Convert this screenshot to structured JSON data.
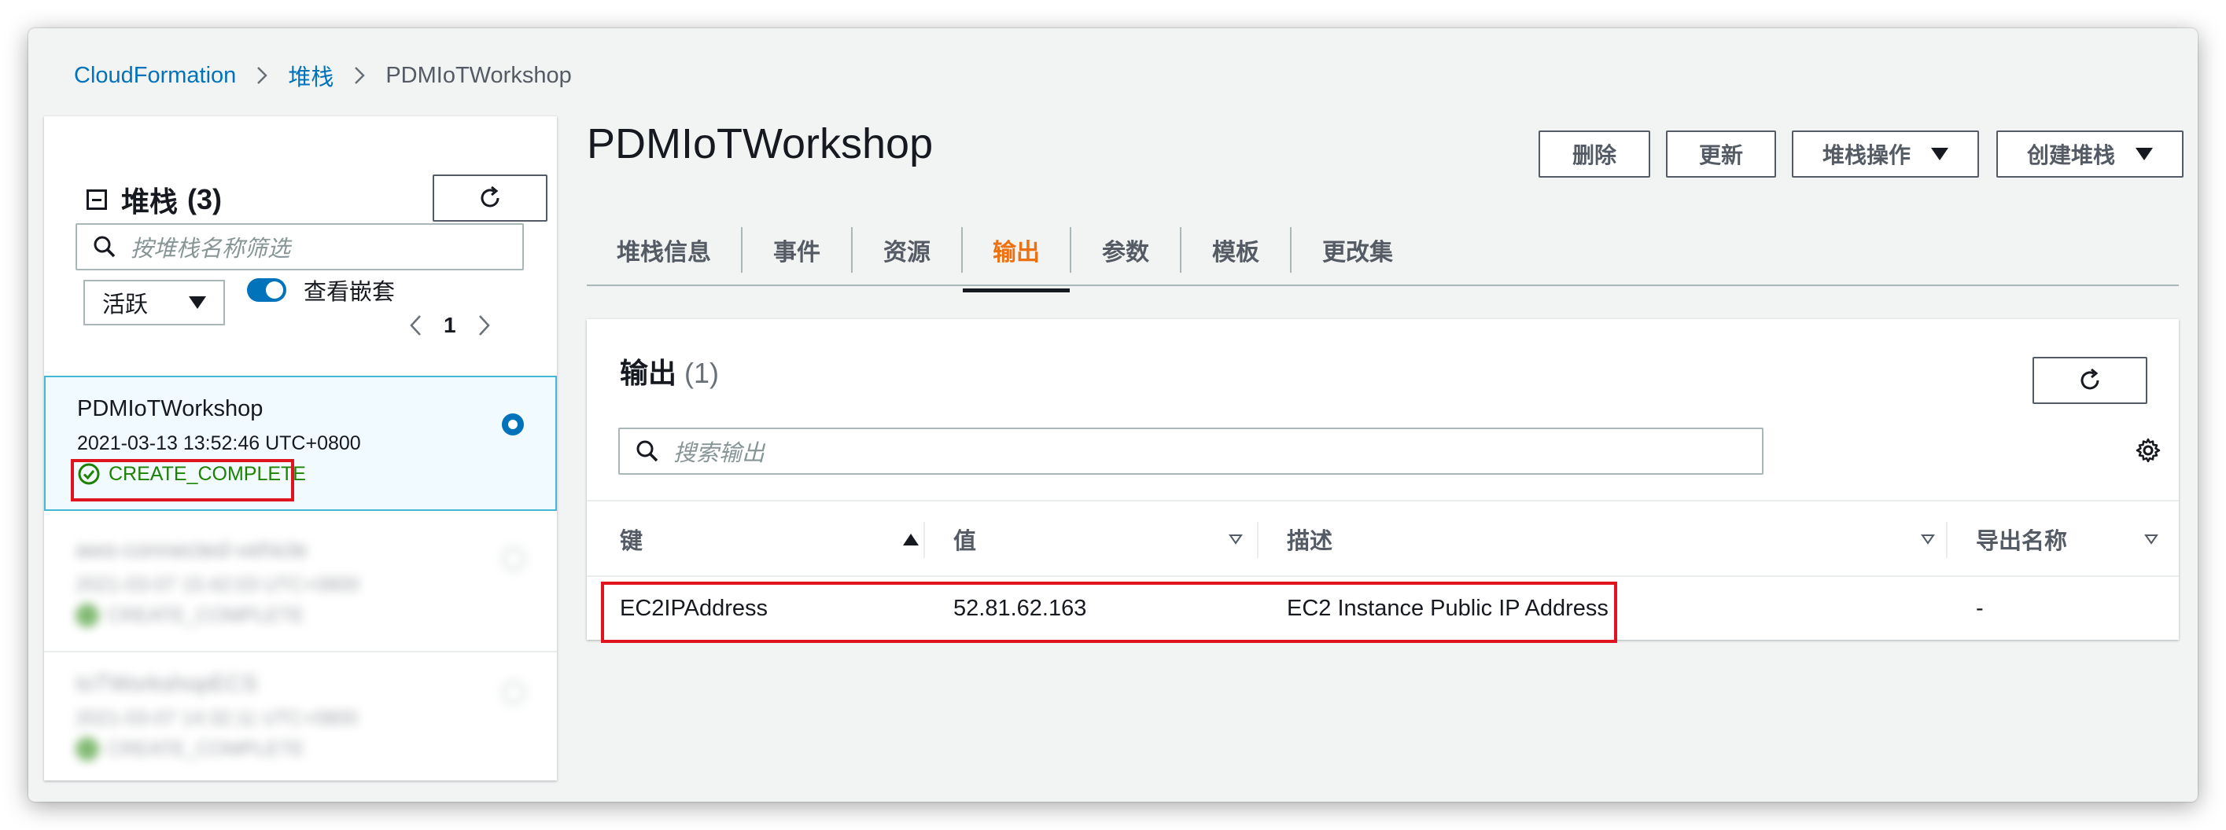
{
  "breadcrumb": {
    "root": "CloudFormation",
    "parent": "堆栈",
    "current": "PDMIoTWorkshop"
  },
  "sidebar": {
    "title": "堆栈",
    "count": "(3)",
    "search_placeholder": "按堆栈名称筛选",
    "filter_value": "活跃",
    "toggle_label": "查看嵌套",
    "page": "1",
    "selected_stack": {
      "name": "PDMIoTWorkshop",
      "date": "2021-03-13 13:52:46 UTC+0800",
      "status": "CREATE_COMPLETE"
    },
    "blurred_stacks": [
      {
        "name": "aws-connected-vehicle",
        "date": "2021-03-07 15:42:03 UTC+0800",
        "status": "CREATE_COMPLETE"
      },
      {
        "name": "IoTWorkshopECS",
        "date": "2021-03-07 14:32:11 UTC+0800",
        "status": "CREATE_COMPLETE"
      }
    ]
  },
  "main": {
    "title": "PDMIoTWorkshop",
    "actions": {
      "delete": "删除",
      "update": "更新",
      "stack_actions": "堆栈操作",
      "create_stack": "创建堆栈"
    },
    "tabs": [
      "堆栈信息",
      "事件",
      "资源",
      "输出",
      "参数",
      "模板",
      "更改集"
    ],
    "active_tab": "输出"
  },
  "outputs": {
    "title": "输出",
    "count": "(1)",
    "search_placeholder": "搜索输出",
    "columns": {
      "key": "键",
      "value": "值",
      "description": "描述",
      "export_name": "导出名称"
    },
    "rows": [
      {
        "key": "EC2IPAddress",
        "value": "52.81.62.163",
        "description": "EC2 Instance Public IP Address",
        "export_name": "-"
      }
    ]
  },
  "colors": {
    "link": "#0073bb",
    "active_tab": "#ec7211",
    "success": "#1d8102",
    "highlight": "#e0141e"
  }
}
